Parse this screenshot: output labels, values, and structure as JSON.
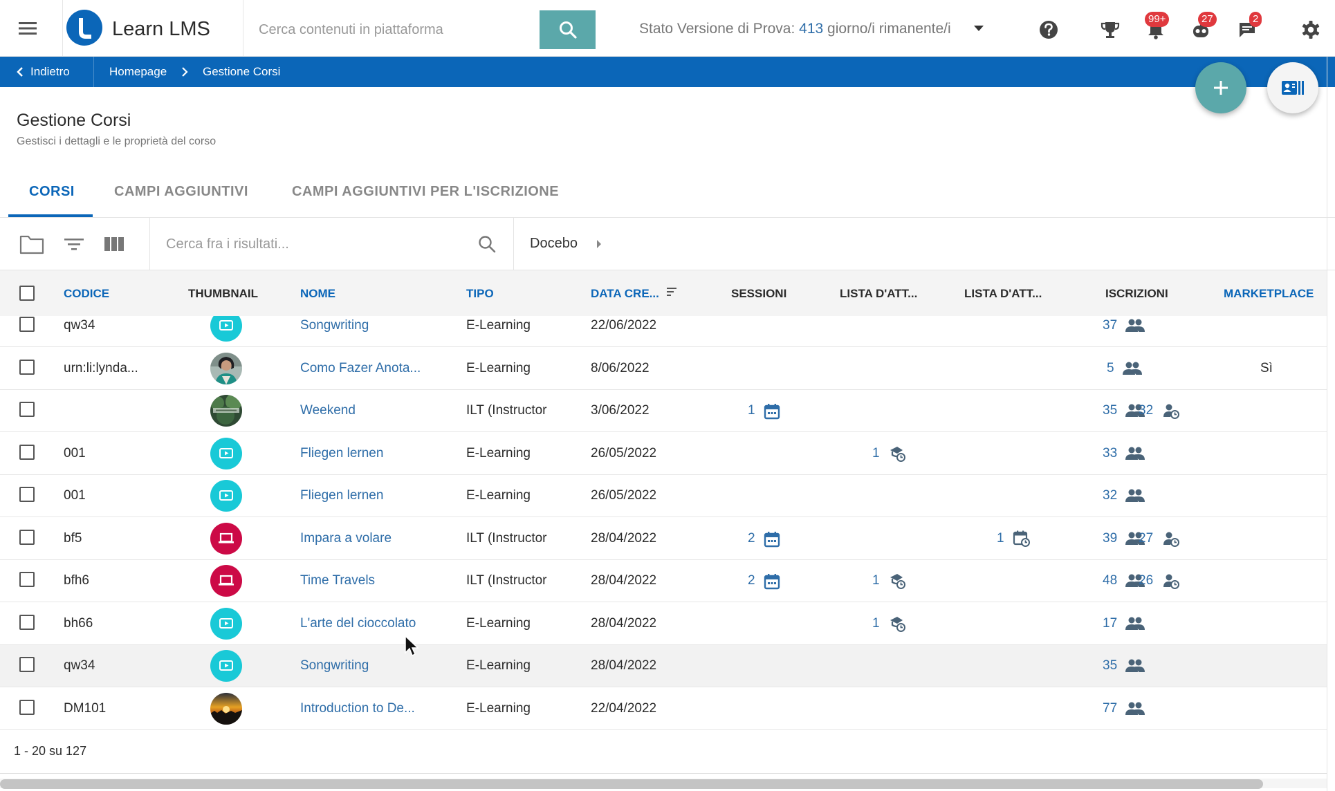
{
  "app": {
    "name": "Learn LMS",
    "search_placeholder": "Cerca contenuti in piattaforma",
    "trial_label": "Stato Versione di Prova:",
    "trial_days": "413",
    "trial_suffix": "giorno/i rimanente/i",
    "badges": {
      "notifications": "99+",
      "assistant": "27",
      "messages": "2"
    }
  },
  "breadcrumb": {
    "back": "Indietro",
    "home": "Homepage",
    "current": "Gestione Corsi"
  },
  "page": {
    "title": "Gestione Corsi",
    "subtitle": "Gestisci i dettagli e le proprietà del corso"
  },
  "tabs": [
    {
      "label": "CORSI",
      "active": true
    },
    {
      "label": "CAMPI AGGIUNTIVI",
      "active": false
    },
    {
      "label": "CAMPI AGGIUNTIVI PER L'ISCRIZIONE",
      "active": false
    }
  ],
  "toolbar": {
    "search_placeholder": "Cerca fra i risultati...",
    "folder_crumb": "Docebo"
  },
  "table": {
    "columns": {
      "code": "CODICE",
      "thumbnail": "THUMBNAIL",
      "name": "NOME",
      "type": "TIPO",
      "created": "DATA CRE...",
      "sessions": "SESSIONI",
      "waitlist1": "LISTA D'ATT...",
      "waitlist2": "LISTA D'ATT...",
      "enrollments": "ISCRIZIONI",
      "marketplace": "MARKETPLACE"
    },
    "rows": [
      {
        "code": "qw34",
        "thumb": "elearning",
        "name": "Songwriting",
        "type": "E-Learning",
        "created": "22/06/2022",
        "sessions": "",
        "waitlist1": "",
        "waitlist2": "",
        "enrollments": "37",
        "pending": "",
        "marketplace": ""
      },
      {
        "code": "urn:li:lynda...",
        "thumb": "photo-portrait",
        "name": "Como Fazer Anota...",
        "type": "E-Learning",
        "created": "8/06/2022",
        "sessions": "",
        "waitlist1": "",
        "waitlist2": "",
        "enrollments": "5",
        "pending": "",
        "marketplace": "Sì"
      },
      {
        "code": "",
        "thumb": "photo-forest",
        "name": "Weekend",
        "type": "ILT (Instructor",
        "created": "3/06/2022",
        "sessions": "1",
        "waitlist1": "",
        "waitlist2": "",
        "enrollments": "35",
        "pending": "32",
        "marketplace": ""
      },
      {
        "code": "001",
        "thumb": "elearning",
        "name": "Fliegen lernen",
        "type": "E-Learning",
        "created": "26/05/2022",
        "sessions": "",
        "waitlist1": "1",
        "waitlist2": "",
        "enrollments": "33",
        "pending": "",
        "marketplace": ""
      },
      {
        "code": "001",
        "thumb": "elearning",
        "name": "Fliegen lernen",
        "type": "E-Learning",
        "created": "26/05/2022",
        "sessions": "",
        "waitlist1": "",
        "waitlist2": "",
        "enrollments": "32",
        "pending": "",
        "marketplace": ""
      },
      {
        "code": "bf5",
        "thumb": "ilt",
        "name": "Impara a volare",
        "type": "ILT (Instructor",
        "created": "28/04/2022",
        "sessions": "2",
        "waitlist1": "",
        "waitlist2": "1",
        "enrollments": "39",
        "pending": "27",
        "marketplace": ""
      },
      {
        "code": "bfh6",
        "thumb": "ilt",
        "name": "Time Travels",
        "type": "ILT (Instructor",
        "created": "28/04/2022",
        "sessions": "2",
        "waitlist1": "1",
        "waitlist2": "",
        "enrollments": "48",
        "pending": "26",
        "marketplace": ""
      },
      {
        "code": "bh66",
        "thumb": "elearning",
        "name": "L'arte del cioccolato",
        "type": "E-Learning",
        "created": "28/04/2022",
        "sessions": "",
        "waitlist1": "1",
        "waitlist2": "",
        "enrollments": "17",
        "pending": "",
        "marketplace": ""
      },
      {
        "code": "qw34",
        "thumb": "elearning",
        "name": "Songwriting",
        "type": "E-Learning",
        "created": "28/04/2022",
        "sessions": "",
        "waitlist1": "",
        "waitlist2": "",
        "enrollments": "35",
        "pending": "",
        "marketplace": ""
      },
      {
        "code": "DM101",
        "thumb": "photo-sunset",
        "name": "Introduction to De...",
        "type": "E-Learning",
        "created": "22/04/2022",
        "sessions": "",
        "waitlist1": "",
        "waitlist2": "",
        "enrollments": "77",
        "pending": "",
        "marketplace": ""
      }
    ],
    "footer": "1 - 20 su 127"
  },
  "colors": {
    "brand_blue": "#0b66b8",
    "teal": "#5ba8aa",
    "elearning_thumb": "#19c9d7",
    "ilt_thumb": "#cc0a46",
    "badge_red": "#e0393e"
  },
  "icons": {
    "menu": "hamburger-icon",
    "search": "search-icon",
    "help": "help-icon",
    "trophy": "trophy-icon",
    "bell": "bell-icon",
    "assistant": "robot-icon",
    "messages": "chat-icon",
    "settings": "gear-icon",
    "add": "plus-icon",
    "card": "id-card-icon",
    "folder": "folder-icon",
    "filter": "filter-icon",
    "columns": "columns-icon",
    "calendar": "calendar-icon",
    "waitlist": "waitlist-icon",
    "users": "users-icon",
    "user_clock": "user-clock-icon"
  }
}
